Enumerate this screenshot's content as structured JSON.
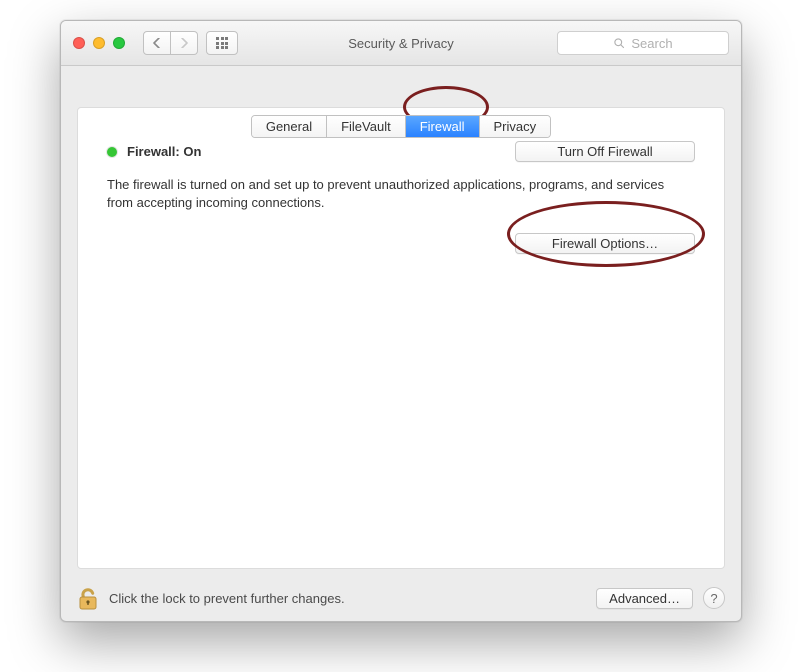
{
  "titlebar": {
    "title": "Security & Privacy",
    "search_placeholder": "Search"
  },
  "tabs": {
    "general": "General",
    "filevault": "FileVault",
    "firewall": "Firewall",
    "privacy": "Privacy"
  },
  "status": {
    "label": "Firewall: On",
    "turn_off": "Turn Off Firewall",
    "description": "The firewall is turned on and set up to prevent unauthorized applications, programs, and services from accepting incoming connections.",
    "options": "Firewall Options…"
  },
  "footer": {
    "lock_text": "Click the lock to prevent further changes.",
    "advanced": "Advanced…",
    "help": "?"
  }
}
